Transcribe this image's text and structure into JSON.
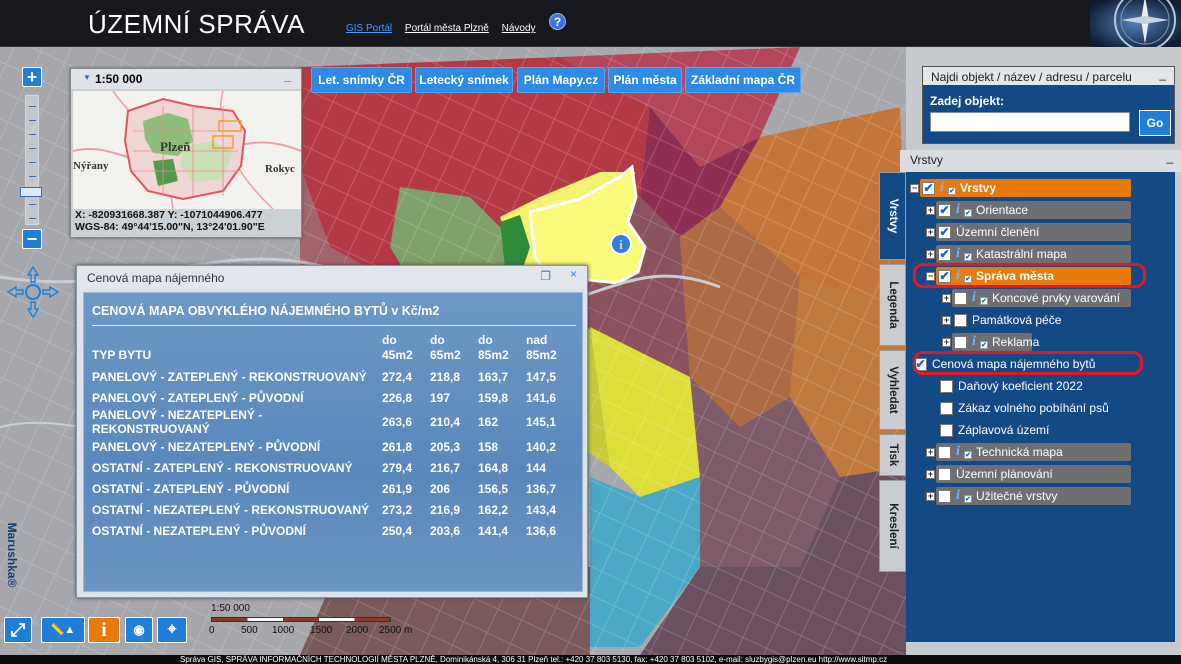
{
  "header": {
    "title": "ÚZEMNÍ SPRÁVA",
    "links": [
      "GIS Portál",
      "Portál města Plzně",
      "Návody"
    ],
    "help": "?"
  },
  "map_buttons": [
    "Let. snímky ČR",
    "Letecký snímek",
    "Plán Mapy.cz",
    "Plán města",
    "Základní mapa ČR"
  ],
  "zoom": {
    "plus": "+",
    "minus": "−"
  },
  "overview": {
    "scale": "1:50 000",
    "min": "_",
    "labels": [
      "Plzeň",
      "Nýřany",
      "Rokyc"
    ],
    "coords_xy": "X: -820931668.387 Y: -1071044906.477",
    "coords_wgs": "WGS-84: 49°44'15.00\"N, 13°24'01.90\"E"
  },
  "rent_panel": {
    "window_title": "Cenová mapa nájemného",
    "title": "CENOVÁ MAPA OBVYKLÉHO NÁJEMNÉHO BYTŮ v Kč/m2",
    "header_type": "TYP BYTU",
    "columns": [
      [
        "do",
        "45m2"
      ],
      [
        "do",
        "65m2"
      ],
      [
        "do",
        "85m2"
      ],
      [
        "nad",
        "85m2"
      ]
    ],
    "rows": [
      {
        "type": "PANELOVÝ - ZATEPLENÝ - REKONSTRUOVANÝ",
        "values": [
          "272,4",
          "218,8",
          "163,7",
          "147,5"
        ]
      },
      {
        "type": "PANELOVÝ - ZATEPLENÝ - PŮVODNÍ",
        "values": [
          "226,8",
          "197",
          "159,8",
          "141,6"
        ]
      },
      {
        "type": "PANELOVÝ - NEZATEPLENÝ - REKONSTRUOVANÝ",
        "values": [
          "263,6",
          "210,4",
          "162",
          "145,1"
        ]
      },
      {
        "type": "PANELOVÝ - NEZATEPLENÝ - PŮVODNÍ",
        "values": [
          "261,8",
          "205,3",
          "158",
          "140,2"
        ]
      },
      {
        "type": "OSTATNÍ - ZATEPLENÝ - REKONSTRUOVANÝ",
        "values": [
          "279,4",
          "216,7",
          "164,8",
          "144"
        ]
      },
      {
        "type": "OSTATNÍ - ZATEPLENÝ - PŮVODNÍ",
        "values": [
          "261,9",
          "206",
          "156,5",
          "136,7"
        ]
      },
      {
        "type": "OSTATNÍ - NEZATEPLENÝ - REKONSTRUOVANÝ",
        "values": [
          "273,2",
          "216,9",
          "162,2",
          "143,4"
        ]
      },
      {
        "type": "OSTATNÍ - NEZATEPLENÝ - PŮVODNÍ",
        "values": [
          "250,4",
          "203,6",
          "141,4",
          "136,6"
        ]
      }
    ]
  },
  "scalebar": {
    "scale": "1:50 000",
    "ticks": [
      "0",
      "500",
      "1000",
      "1500",
      "2000",
      "2500 m"
    ]
  },
  "search": {
    "header": "Najdi objekt / název / adresu / parcelu",
    "label": "Zadej objekt:",
    "value": "",
    "go": "Go"
  },
  "layers_header": "Vrstvy",
  "side_tabs": [
    "Vrstvy",
    "Legenda",
    "Vyhledat",
    "Tisk",
    "Kreslení"
  ],
  "layers": [
    {
      "label": "Vrstvy",
      "checked": true,
      "info": true
    },
    {
      "label": "Orientace",
      "checked": true,
      "info": true
    },
    {
      "label": "Územní členění",
      "checked": true,
      "info": false
    },
    {
      "label": "Katastrální mapa",
      "checked": true,
      "info": true
    },
    {
      "label": "Správa města",
      "checked": true,
      "info": true
    },
    {
      "label": "Koncové prvky varování",
      "checked": false,
      "info": true
    },
    {
      "label": "Památková péče",
      "checked": false,
      "info": false
    },
    {
      "label": "Reklama",
      "checked": false,
      "info": true
    },
    {
      "label": "Cenová mapa nájemného bytů",
      "checked": true,
      "info": false
    },
    {
      "label": "Daňový koeficient 2022",
      "checked": false,
      "info": false
    },
    {
      "label": "Zákaz volného pobíhání psů",
      "checked": false,
      "info": false
    },
    {
      "label": "Záplavová území",
      "checked": false,
      "info": false
    },
    {
      "label": "Technická mapa",
      "checked": false,
      "info": true
    },
    {
      "label": "Územní plánování",
      "checked": false,
      "info": false
    },
    {
      "label": "Užitečné vrstvy",
      "checked": false,
      "info": true
    }
  ],
  "brand": "Marushka®",
  "footer": "Správa GIS, SPRÁVA INFORMAČNÍCH TECHNOLOGIÍ MĚSTA PLZNĚ, Dominikánská 4, 306 31 Plzeň tel.: +420 37 803 5130, fax: +420 37 803 5102, e-mail: sluzbygis@plzen.eu http://www.sitmp.cz",
  "colors": {
    "accent": "#1f7fd8",
    "panel": "#134a86",
    "orange": "#e87a0c",
    "highlight": "#e3171f"
  }
}
